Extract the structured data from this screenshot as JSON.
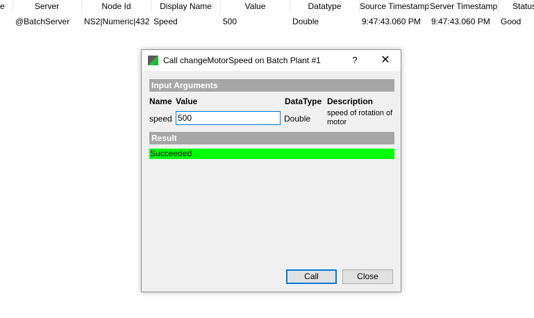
{
  "table": {
    "columns": [
      "e",
      "Server",
      "Node Id",
      "Display Name",
      "Value",
      "Datatype",
      "Source Timestamp",
      "Server Timestamp",
      "Status"
    ],
    "rows": [
      {
        "server": "@BatchServer",
        "node_id": "NS2|Numeric|432",
        "display_name": "Speed",
        "value": "500",
        "datatype": "Double",
        "source_timestamp": "9:47:43.060 PM",
        "server_timestamp": "9:47:43.060 PM",
        "status": "Good"
      }
    ]
  },
  "dialog": {
    "title": "Call changeMotorSpeed on Batch Plant #1",
    "help_label": "?",
    "close_symbol": "✕",
    "input_section": "Input Arguments",
    "headers": {
      "name": "Name",
      "value": "Value",
      "datatype": "DataType",
      "description": "Description"
    },
    "argument": {
      "name": "speed",
      "value": "500",
      "datatype": "Double",
      "description": "speed of rotation of motor"
    },
    "result_section": "Result",
    "result_text": "Succeeded",
    "call_label": "Call",
    "close_label": "Close"
  },
  "colors": {
    "section_bar": "#a6a6a6",
    "success": "#00ff00",
    "focus": "#0078d7"
  }
}
